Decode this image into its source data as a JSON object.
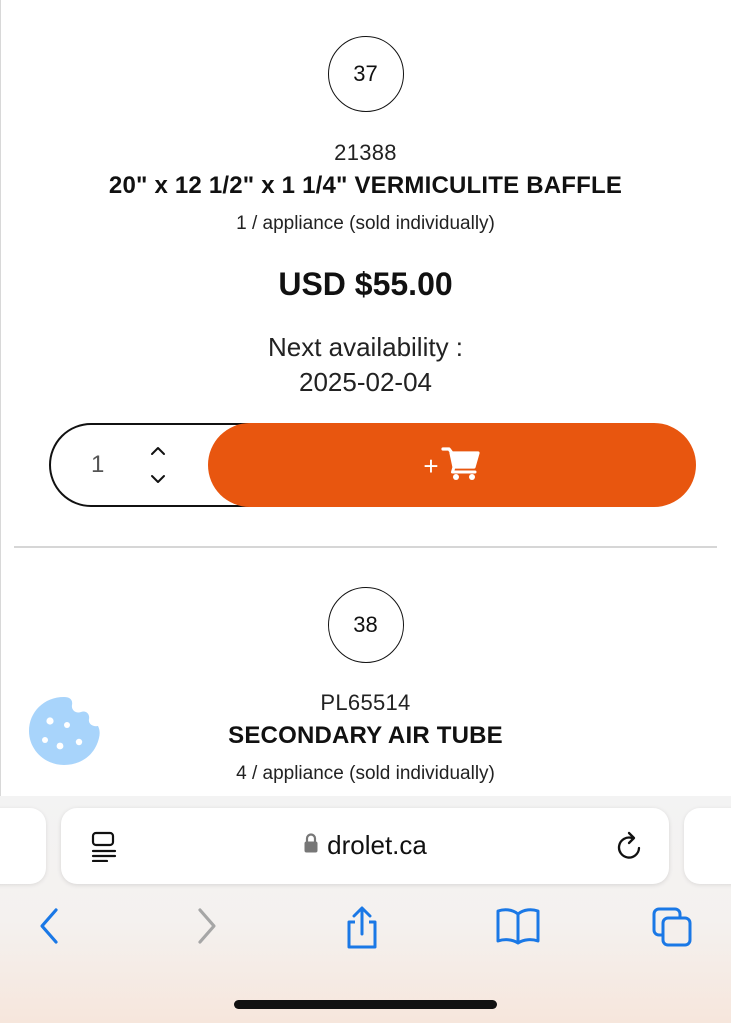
{
  "products": [
    {
      "index": "37",
      "sku": "21388",
      "title": "20\" x 12 1/2\" x 1 1/4\" VERMICULITE BAFFLE",
      "quantity_note": "1 / appliance (sold individually)",
      "price": "USD $55.00",
      "availability_label": "Next availability :",
      "availability_date": "2025-02-04",
      "quantity_value": "1",
      "add_label": "+"
    },
    {
      "index": "38",
      "sku": "PL65514",
      "title": "SECONDARY AIR TUBE",
      "quantity_note": "4 / appliance (sold individually)"
    }
  ],
  "colors": {
    "accent": "#e8560f",
    "cookie": "#a8d4fb",
    "browser_link": "#1a78e6"
  },
  "browser": {
    "url": "drolet.ca",
    "icons": {
      "reader": "reader-icon",
      "lock": "lock-icon",
      "reload": "reload-icon",
      "back": "back-icon",
      "forward": "forward-icon",
      "share": "share-icon",
      "bookmarks": "bookmarks-icon",
      "tabs": "tabs-icon"
    }
  }
}
